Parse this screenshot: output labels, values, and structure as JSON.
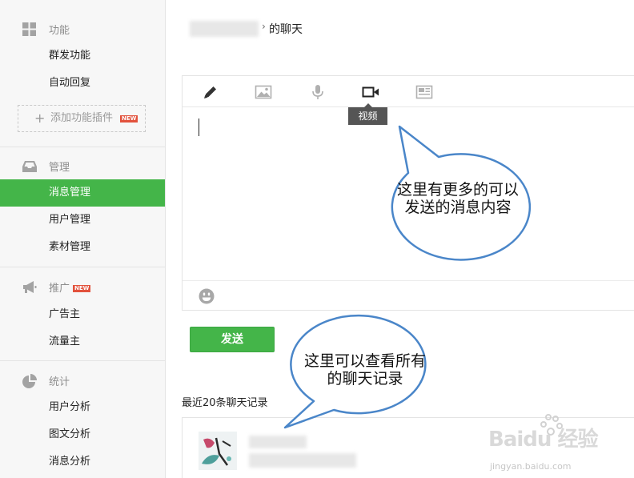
{
  "sidebar": {
    "sections": [
      {
        "icon": "grid-icon",
        "title": "功能",
        "items": [
          "群发功能",
          "自动回复"
        ]
      },
      {
        "icon": "inbox-icon",
        "title": "管理",
        "items": [
          "消息管理",
          "用户管理",
          "素材管理"
        ]
      },
      {
        "icon": "megaphone-icon",
        "title": "推广",
        "badge": "NEW",
        "items": [
          "广告主",
          "流量主"
        ]
      },
      {
        "icon": "pie-chart-icon",
        "title": "统计",
        "items": [
          "用户分析",
          "图文分析",
          "消息分析"
        ]
      }
    ],
    "add_plugin_label": "添加功能插件",
    "add_plugin_badge": "NEW",
    "active_item": "消息管理"
  },
  "header": {
    "chat_title": "的聊天"
  },
  "editor": {
    "tools": [
      "pencil-icon",
      "image-icon",
      "microphone-icon",
      "video-icon",
      "news-icon"
    ],
    "active_tool": "video-icon",
    "tooltip": "视频"
  },
  "send_button": "发送",
  "history_label": "最近20条聊天记录",
  "callouts": {
    "first": "这里有更多的可以发送的消息内容",
    "second": "这里可以查看所有的聊天记录"
  },
  "watermark": {
    "brand": "Baidu 经验",
    "url": "jingyan.baidu.com"
  },
  "colors": {
    "accent": "#44b549",
    "callout_border": "#4a86c9",
    "badge": "#e2523d"
  }
}
